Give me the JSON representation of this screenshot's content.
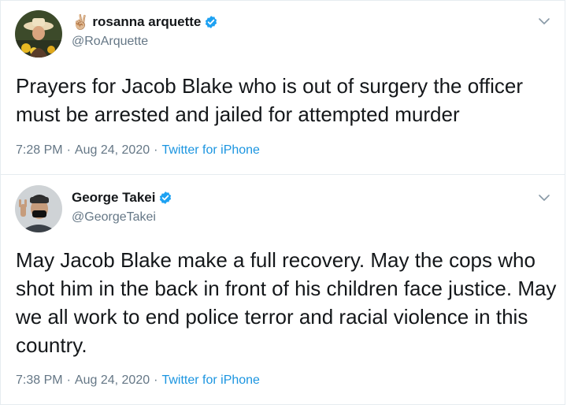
{
  "tweets": [
    {
      "name_emoji": "✌🏼",
      "display_name": "rosanna arquette",
      "handle": "@RoArquette",
      "text": "Prayers for Jacob Blake who is out of surgery the officer must be arrested and jailed for attempted murder",
      "time": "7:28 PM",
      "date": "Aug 24, 2020",
      "source": "Twitter for iPhone",
      "verified": true
    },
    {
      "name_emoji": "",
      "display_name": "George Takei",
      "handle": "@GeorgeTakei",
      "text": "May Jacob Blake make a full recovery. May the cops who shot him in the back in front of his children face justice. May we all work to end police terror and racial violence in this country.",
      "time": "7:38 PM",
      "date": "Aug 24, 2020",
      "source": "Twitter for iPhone",
      "verified": true
    }
  ],
  "meta_separator": "·",
  "colors": {
    "verified": "#1da1f2",
    "link": "#1b95e0",
    "muted": "#657786",
    "border": "#e6ecf0"
  },
  "icons": {
    "verified": "verified-badge-icon",
    "menu": "chevron-down-icon"
  }
}
